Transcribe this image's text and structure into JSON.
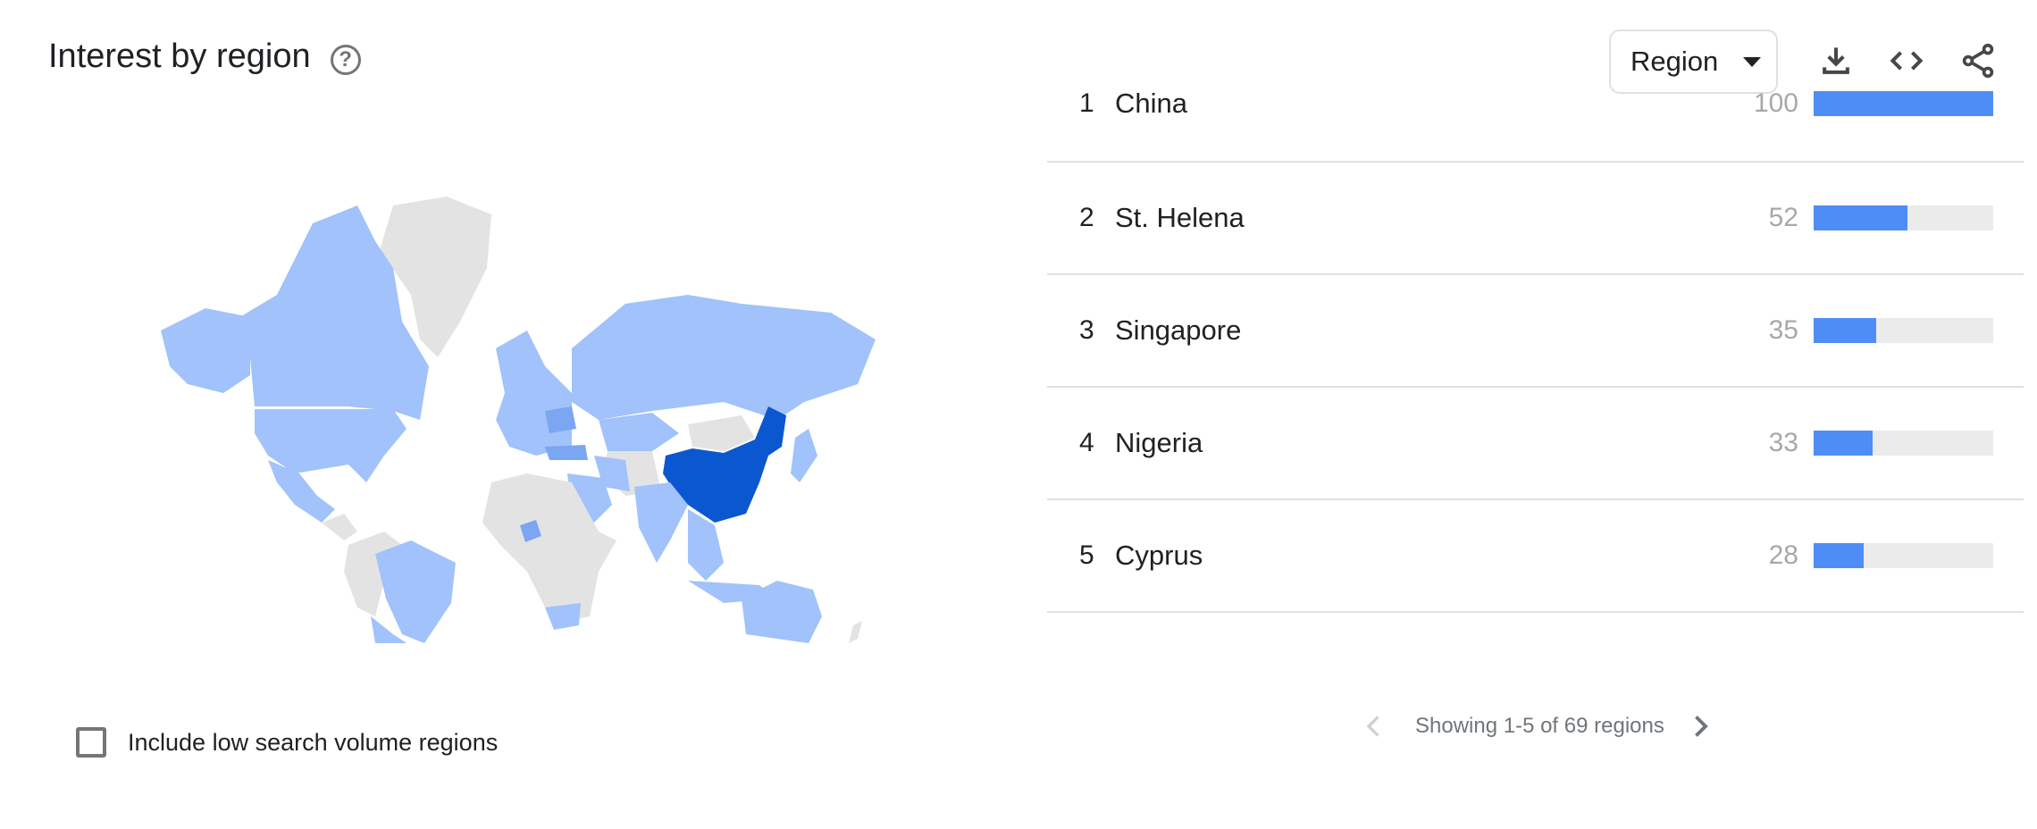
{
  "header": {
    "title": "Interest by region",
    "help_icon": "help-circle-icon",
    "help_glyph": "?"
  },
  "toolbar": {
    "region_select": {
      "selected": "Region",
      "icon": "dropdown-caret-icon"
    },
    "download_icon": "download-icon",
    "embed_icon": "embed-code-icon",
    "share_icon": "share-icon"
  },
  "colors": {
    "bar_fill": "#4e8df5",
    "bar_track": "#ebebeb",
    "map_top": "#0b57d0",
    "map_mid": "#7ba6f2",
    "map_low": "#a1c2fa",
    "map_none": "#e3e3e3"
  },
  "regions": [
    {
      "rank": "1",
      "name": "China",
      "value": "100",
      "score": 100
    },
    {
      "rank": "2",
      "name": "St. Helena",
      "value": "52",
      "score": 52
    },
    {
      "rank": "3",
      "name": "Singapore",
      "value": "35",
      "score": 35
    },
    {
      "rank": "4",
      "name": "Nigeria",
      "value": "33",
      "score": 33
    },
    {
      "rank": "5",
      "name": "Cyprus",
      "value": "28",
      "score": 28
    }
  ],
  "pagination": {
    "text": "Showing 1-5 of 69 regions",
    "prev_icon": "chevron-left-icon",
    "next_icon": "chevron-right-icon",
    "prev_enabled": false,
    "next_enabled": true
  },
  "options": {
    "low_volume_label": "Include low search volume regions",
    "low_volume_checked": false
  },
  "map": {
    "highlighted": [
      {
        "region": "China",
        "level": "top"
      },
      {
        "region": "Nigeria",
        "level": "mid"
      },
      {
        "region": "Turkey",
        "level": "mid"
      },
      {
        "region": "Ukraine",
        "level": "mid"
      },
      {
        "region": "Canada",
        "level": "low"
      },
      {
        "region": "United States",
        "level": "low"
      },
      {
        "region": "Mexico",
        "level": "low"
      },
      {
        "region": "Brazil",
        "level": "low"
      },
      {
        "region": "Argentina",
        "level": "low"
      },
      {
        "region": "Russia",
        "level": "low"
      },
      {
        "region": "Kazakhstan",
        "level": "low"
      },
      {
        "region": "India",
        "level": "low"
      },
      {
        "region": "Australia",
        "level": "low"
      },
      {
        "region": "South Africa",
        "level": "low"
      },
      {
        "region": "Saudi Arabia",
        "level": "low"
      },
      {
        "region": "Europe",
        "level": "low"
      },
      {
        "region": "Japan",
        "level": "low"
      },
      {
        "region": "Southeast Asia",
        "level": "low"
      }
    ],
    "no_data": [
      "Greenland",
      "Africa (most)",
      "Mongolia",
      "Middle East (part)",
      "Central Asia (part)",
      "Bolivia/Peru/Colombia"
    ]
  }
}
